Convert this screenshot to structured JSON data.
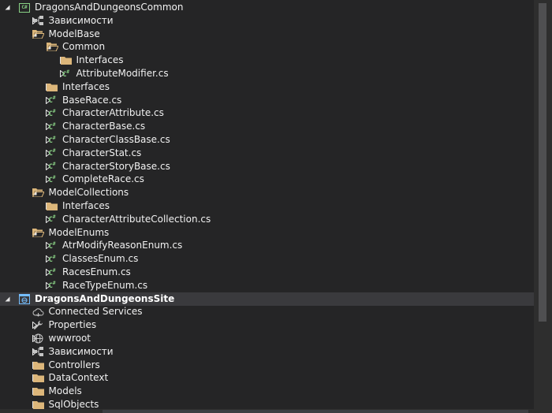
{
  "tree": {
    "items": [
      {
        "label": "DragonsAndDungeonsCommon",
        "icon": "csharp-project-icon",
        "expand": "expanded",
        "level": 0,
        "bold": false
      },
      {
        "label": "Зависимости",
        "icon": "dependencies-icon",
        "expand": "collapsed",
        "level": 1
      },
      {
        "label": "ModelBase",
        "icon": "folder-open-icon",
        "expand": "expanded",
        "level": 1
      },
      {
        "label": "Common",
        "icon": "folder-open-icon",
        "expand": "expanded",
        "level": 2
      },
      {
        "label": "Interfaces",
        "icon": "folder-icon",
        "expand": "collapsed",
        "level": 3
      },
      {
        "label": "AttributeModifier.cs",
        "icon": "csharp-file-icon",
        "expand": "collapsed",
        "level": 3
      },
      {
        "label": "Interfaces",
        "icon": "folder-icon",
        "expand": "collapsed",
        "level": 2
      },
      {
        "label": "BaseRace.cs",
        "icon": "csharp-file-icon",
        "expand": "collapsed",
        "level": 2
      },
      {
        "label": "CharacterAttribute.cs",
        "icon": "csharp-file-icon",
        "expand": "collapsed",
        "level": 2
      },
      {
        "label": "CharacterBase.cs",
        "icon": "csharp-file-icon",
        "expand": "collapsed",
        "level": 2
      },
      {
        "label": "CharacterClassBase.cs",
        "icon": "csharp-file-icon",
        "expand": "collapsed",
        "level": 2
      },
      {
        "label": "CharacterStat.cs",
        "icon": "csharp-file-icon",
        "expand": "collapsed",
        "level": 2
      },
      {
        "label": "CharacterStoryBase.cs",
        "icon": "csharp-file-icon",
        "expand": "collapsed",
        "level": 2
      },
      {
        "label": "CompleteRace.cs",
        "icon": "csharp-file-icon",
        "expand": "collapsed",
        "level": 2
      },
      {
        "label": "ModelCollections",
        "icon": "folder-open-icon",
        "expand": "expanded",
        "level": 1
      },
      {
        "label": "Interfaces",
        "icon": "folder-icon",
        "expand": "collapsed",
        "level": 2
      },
      {
        "label": "CharacterAttributeCollection.cs",
        "icon": "csharp-file-icon",
        "expand": "collapsed",
        "level": 2
      },
      {
        "label": "ModelEnums",
        "icon": "folder-open-icon",
        "expand": "expanded",
        "level": 1
      },
      {
        "label": "AtrModifyReasonEnum.cs",
        "icon": "csharp-file-icon",
        "expand": "collapsed",
        "level": 2
      },
      {
        "label": "ClassesEnum.cs",
        "icon": "csharp-file-icon",
        "expand": "collapsed",
        "level": 2
      },
      {
        "label": "RacesEnum.cs",
        "icon": "csharp-file-icon",
        "expand": "collapsed",
        "level": 2
      },
      {
        "label": "RaceTypeEnum.cs",
        "icon": "csharp-file-icon",
        "expand": "collapsed",
        "level": 2
      },
      {
        "label": "DragonsAndDungeonsSite",
        "icon": "web-project-icon",
        "expand": "expanded",
        "level": 0,
        "selected": true
      },
      {
        "label": "Connected Services",
        "icon": "connected-services-icon",
        "expand": "none",
        "level": 1
      },
      {
        "label": "Properties",
        "icon": "wrench-icon",
        "expand": "collapsed",
        "level": 1
      },
      {
        "label": "wwwroot",
        "icon": "globe-icon",
        "expand": "collapsed",
        "level": 1
      },
      {
        "label": "Зависимости",
        "icon": "dependencies-icon",
        "expand": "collapsed",
        "level": 1
      },
      {
        "label": "Controllers",
        "icon": "folder-icon",
        "expand": "collapsed",
        "level": 1
      },
      {
        "label": "DataContext",
        "icon": "folder-icon",
        "expand": "collapsed",
        "level": 1
      },
      {
        "label": "Models",
        "icon": "folder-icon",
        "expand": "collapsed",
        "level": 1
      },
      {
        "label": "SqlObjects",
        "icon": "folder-icon",
        "expand": "collapsed",
        "level": 1
      }
    ]
  },
  "colors": {
    "background": "#252526",
    "text": "#f1f1f1",
    "folder": "#dcb67a",
    "csharp": "#89d185",
    "selected": "#3a3a3d"
  }
}
